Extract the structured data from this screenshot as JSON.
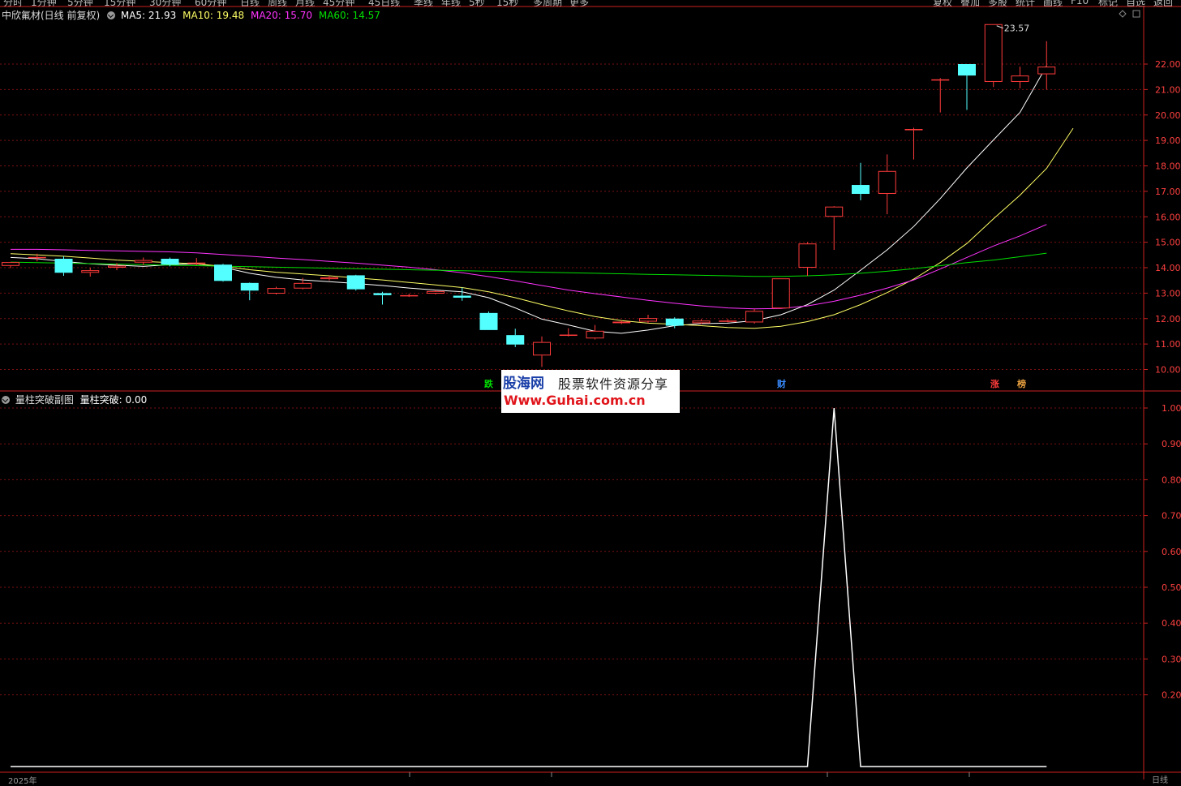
{
  "toolbar": {
    "left": [
      "分时",
      "1分钟",
      "5分钟",
      "15分钟",
      "30分钟",
      "60分钟",
      "日线",
      "周线",
      "月线",
      "45分钟",
      "45日线",
      "季线",
      "年线",
      "5秒",
      "15秒",
      "多周期",
      "更多"
    ],
    "right": [
      "复权",
      "叠加",
      "多股",
      "统计",
      "画线",
      "F10",
      "标记",
      "自选",
      "返回"
    ]
  },
  "main_header": {
    "title": "中欣氟材(日线 前复权)",
    "ma5": "MA5: 21.93",
    "ma10": "MA10: 19.48",
    "ma20": "MA20: 15.70",
    "ma60": "MA60: 14.57"
  },
  "sub_header": {
    "title": "量柱突破副图",
    "value": "量柱突破: 0.00"
  },
  "markers": {
    "die": "跌",
    "cai": "财",
    "zhang": "涨",
    "bang": "榜"
  },
  "peak_label": "23.57",
  "watermark": {
    "brand": "股海网",
    "slogan": "股票软件资源分享",
    "url": "Www.Guhai.com.cn"
  },
  "bottom_axis": {
    "left": "2025年",
    "right": "日线"
  },
  "colors": {
    "up": "#ff3b3b",
    "down": "#54ffff",
    "ma5": "#ffffff",
    "ma10": "#ffff66",
    "ma20": "#ff33ff",
    "ma60": "#00e000",
    "grid": "#7a1010",
    "axis": "#cc2020"
  },
  "chart_data": [
    {
      "type": "candlestick",
      "y_axis_ticks": [
        10.0,
        11.0,
        12.0,
        13.0,
        14.0,
        15.0,
        16.0,
        17.0,
        18.0,
        19.0,
        20.0,
        21.0,
        22.0
      ],
      "y_axis_tick_labels": [
        "10.00",
        "11.00",
        "12.00",
        "13.00",
        "14.00",
        "15.00",
        "16.00",
        "17.00",
        "18.00",
        "19.00",
        "20.00",
        "21.00",
        "22.00"
      ],
      "ylim": [
        9.6,
        24.0
      ],
      "candles": [
        {
          "o": 14.07,
          "h": 14.22,
          "l": 13.98,
          "c": 14.22
        },
        {
          "o": 14.4,
          "h": 14.55,
          "l": 14.25,
          "c": 14.42
        },
        {
          "o": 14.35,
          "h": 14.45,
          "l": 13.68,
          "c": 13.8
        },
        {
          "o": 13.8,
          "h": 14.0,
          "l": 13.65,
          "c": 13.9
        },
        {
          "o": 14.0,
          "h": 14.18,
          "l": 13.9,
          "c": 14.08
        },
        {
          "o": 14.2,
          "h": 14.4,
          "l": 14.1,
          "c": 14.3
        },
        {
          "o": 14.35,
          "h": 14.4,
          "l": 14.05,
          "c": 14.12
        },
        {
          "o": 14.18,
          "h": 14.38,
          "l": 14.1,
          "c": 14.2
        },
        {
          "o": 14.12,
          "h": 14.15,
          "l": 13.45,
          "c": 13.48
        },
        {
          "o": 13.4,
          "h": 13.42,
          "l": 12.72,
          "c": 13.1
        },
        {
          "o": 12.98,
          "h": 13.25,
          "l": 12.95,
          "c": 13.2
        },
        {
          "o": 13.18,
          "h": 13.6,
          "l": 13.15,
          "c": 13.4
        },
        {
          "o": 13.55,
          "h": 13.68,
          "l": 13.5,
          "c": 13.62
        },
        {
          "o": 13.7,
          "h": 13.72,
          "l": 13.1,
          "c": 13.15
        },
        {
          "o": 13.0,
          "h": 13.05,
          "l": 12.55,
          "c": 12.92
        },
        {
          "o": 12.88,
          "h": 12.98,
          "l": 12.85,
          "c": 12.92
        },
        {
          "o": 12.98,
          "h": 13.12,
          "l": 12.95,
          "c": 13.08
        },
        {
          "o": 12.9,
          "h": 13.22,
          "l": 12.7,
          "c": 12.82
        },
        {
          "o": 12.22,
          "h": 12.28,
          "l": 11.55,
          "c": 11.55
        },
        {
          "o": 11.35,
          "h": 11.6,
          "l": 10.88,
          "c": 10.98
        },
        {
          "o": 10.55,
          "h": 11.3,
          "l": 10.1,
          "c": 11.08
        },
        {
          "o": 11.35,
          "h": 11.62,
          "l": 11.3,
          "c": 11.37
        },
        {
          "o": 11.22,
          "h": 11.75,
          "l": 11.18,
          "c": 11.52
        },
        {
          "o": 11.82,
          "h": 11.92,
          "l": 11.78,
          "c": 11.88
        },
        {
          "o": 11.88,
          "h": 12.15,
          "l": 11.82,
          "c": 12.02
        },
        {
          "o": 12.0,
          "h": 12.05,
          "l": 11.62,
          "c": 11.72
        },
        {
          "o": 11.82,
          "h": 11.98,
          "l": 11.78,
          "c": 11.92
        },
        {
          "o": 11.88,
          "h": 11.98,
          "l": 11.85,
          "c": 11.92
        },
        {
          "o": 11.85,
          "h": 12.38,
          "l": 11.8,
          "c": 12.3
        },
        {
          "o": 12.4,
          "h": 13.58,
          "l": 12.38,
          "c": 13.58
        },
        {
          "o": 14.0,
          "h": 15.0,
          "l": 13.68,
          "c": 14.95
        },
        {
          "o": 16.0,
          "h": 16.42,
          "l": 14.7,
          "c": 16.4
        },
        {
          "o": 17.25,
          "h": 18.12,
          "l": 16.65,
          "c": 16.9
        },
        {
          "o": 16.9,
          "h": 18.45,
          "l": 16.1,
          "c": 17.8
        },
        {
          "o": 19.4,
          "h": 19.5,
          "l": 18.25,
          "c": 19.45
        },
        {
          "o": 21.4,
          "h": 21.45,
          "l": 20.1,
          "c": 21.4
        },
        {
          "o": 22.0,
          "h": 22.0,
          "l": 20.2,
          "c": 21.55
        },
        {
          "o": 21.3,
          "h": 23.57,
          "l": 21.1,
          "c": 23.57
        },
        {
          "o": 21.3,
          "h": 21.9,
          "l": 21.05,
          "c": 21.55
        },
        {
          "o": 21.6,
          "h": 22.9,
          "l": 21.0,
          "c": 21.9
        }
      ],
      "series": [
        {
          "name": "MA5",
          "values": [
            14.4,
            14.35,
            14.25,
            14.15,
            14.1,
            14.05,
            14.12,
            14.15,
            14.02,
            13.78,
            13.62,
            13.52,
            13.45,
            13.38,
            13.3,
            13.2,
            13.12,
            13.05,
            12.82,
            12.42,
            11.98,
            11.75,
            11.5,
            11.42,
            11.55,
            11.72,
            11.8,
            11.82,
            11.92,
            12.15,
            12.55,
            13.12,
            13.9,
            14.7,
            15.62,
            16.72,
            17.92,
            19.02,
            20.1,
            21.93
          ]
        },
        {
          "name": "MA10",
          "values": [
            14.55,
            14.5,
            14.45,
            14.38,
            14.3,
            14.25,
            14.2,
            14.15,
            14.05,
            13.92,
            13.82,
            13.75,
            13.68,
            13.6,
            13.52,
            13.42,
            13.32,
            13.22,
            13.05,
            12.82,
            12.55,
            12.3,
            12.08,
            11.92,
            11.82,
            11.78,
            11.72,
            11.65,
            11.62,
            11.7,
            11.88,
            12.15,
            12.55,
            13.02,
            13.55,
            14.2,
            14.95,
            15.92,
            16.85,
            17.9,
            19.48
          ]
        },
        {
          "name": "MA20",
          "values": [
            14.72,
            14.72,
            14.7,
            14.68,
            14.66,
            14.64,
            14.62,
            14.58,
            14.52,
            14.45,
            14.38,
            14.32,
            14.25,
            14.18,
            14.1,
            14.02,
            13.92,
            13.8,
            13.65,
            13.48,
            13.3,
            13.12,
            12.98,
            12.85,
            12.72,
            12.6,
            12.5,
            12.42,
            12.38,
            12.4,
            12.5,
            12.68,
            12.92,
            13.2,
            13.52,
            13.95,
            14.4,
            14.85,
            15.25,
            15.7
          ]
        },
        {
          "name": "MA60",
          "values": [
            14.22,
            14.2,
            14.18,
            14.16,
            14.14,
            14.12,
            14.1,
            14.08,
            14.06,
            14.04,
            14.02,
            14.0,
            13.98,
            13.96,
            13.94,
            13.92,
            13.9,
            13.88,
            13.86,
            13.84,
            13.82,
            13.8,
            13.78,
            13.76,
            13.74,
            13.72,
            13.7,
            13.68,
            13.66,
            13.66,
            13.68,
            13.72,
            13.78,
            13.86,
            13.96,
            14.08,
            14.2,
            14.3,
            14.43,
            14.57
          ]
        }
      ]
    },
    {
      "type": "line",
      "y_axis_ticks": [
        0.2,
        0.3,
        0.4,
        0.5,
        0.6,
        0.7,
        0.8,
        0.9,
        1.0
      ],
      "y_axis_tick_labels": [
        "0.20",
        "0.30",
        "0.40",
        "0.50",
        "0.60",
        "0.70",
        "0.80",
        "0.90",
        "1.00"
      ],
      "ylim": [
        -0.02,
        1.04
      ],
      "series": [
        {
          "name": "量柱突破",
          "values": [
            0,
            0,
            0,
            0,
            0,
            0,
            0,
            0,
            0,
            0,
            0,
            0,
            0,
            0,
            0,
            0,
            0,
            0,
            0,
            0,
            0,
            0,
            0,
            0,
            0,
            0,
            0,
            0,
            0,
            0,
            0,
            1,
            0,
            0,
            0,
            0,
            0,
            0,
            0,
            0
          ]
        }
      ]
    }
  ]
}
